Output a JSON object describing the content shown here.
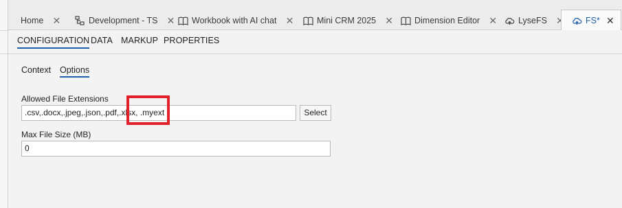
{
  "tabs": [
    {
      "label": "Home",
      "icon": "none",
      "active": false
    },
    {
      "label": "Development - TS",
      "icon": "hierarchy-icon",
      "active": false
    },
    {
      "label": "Workbook with AI chat",
      "icon": "book-icon",
      "active": false
    },
    {
      "label": "Mini CRM 2025",
      "icon": "book-icon",
      "active": false
    },
    {
      "label": "Dimension Editor",
      "icon": "book-icon",
      "active": false
    },
    {
      "label": "LyseFS",
      "icon": "cloud-icon",
      "active": false
    },
    {
      "label": "FS*",
      "icon": "cloud-icon",
      "active": true
    }
  ],
  "close_glyph": "✕",
  "subnav": {
    "configuration": "CONFIGURATION",
    "data": "DATA",
    "markup": "MARKUP",
    "properties": "PROPERTIES"
  },
  "innertabs": {
    "context": "Context",
    "options": "Options"
  },
  "form": {
    "allowed_label": "Allowed File Extensions",
    "allowed_value": ".csv,.docx,.jpeg,.json,.pdf,.xlsx, .myext",
    "select_label": "Select",
    "max_size_label": "Max File Size (MB)",
    "max_size_value": "0"
  },
  "colors": {
    "accent": "#1b5fa8",
    "highlight": "#e0202a"
  }
}
